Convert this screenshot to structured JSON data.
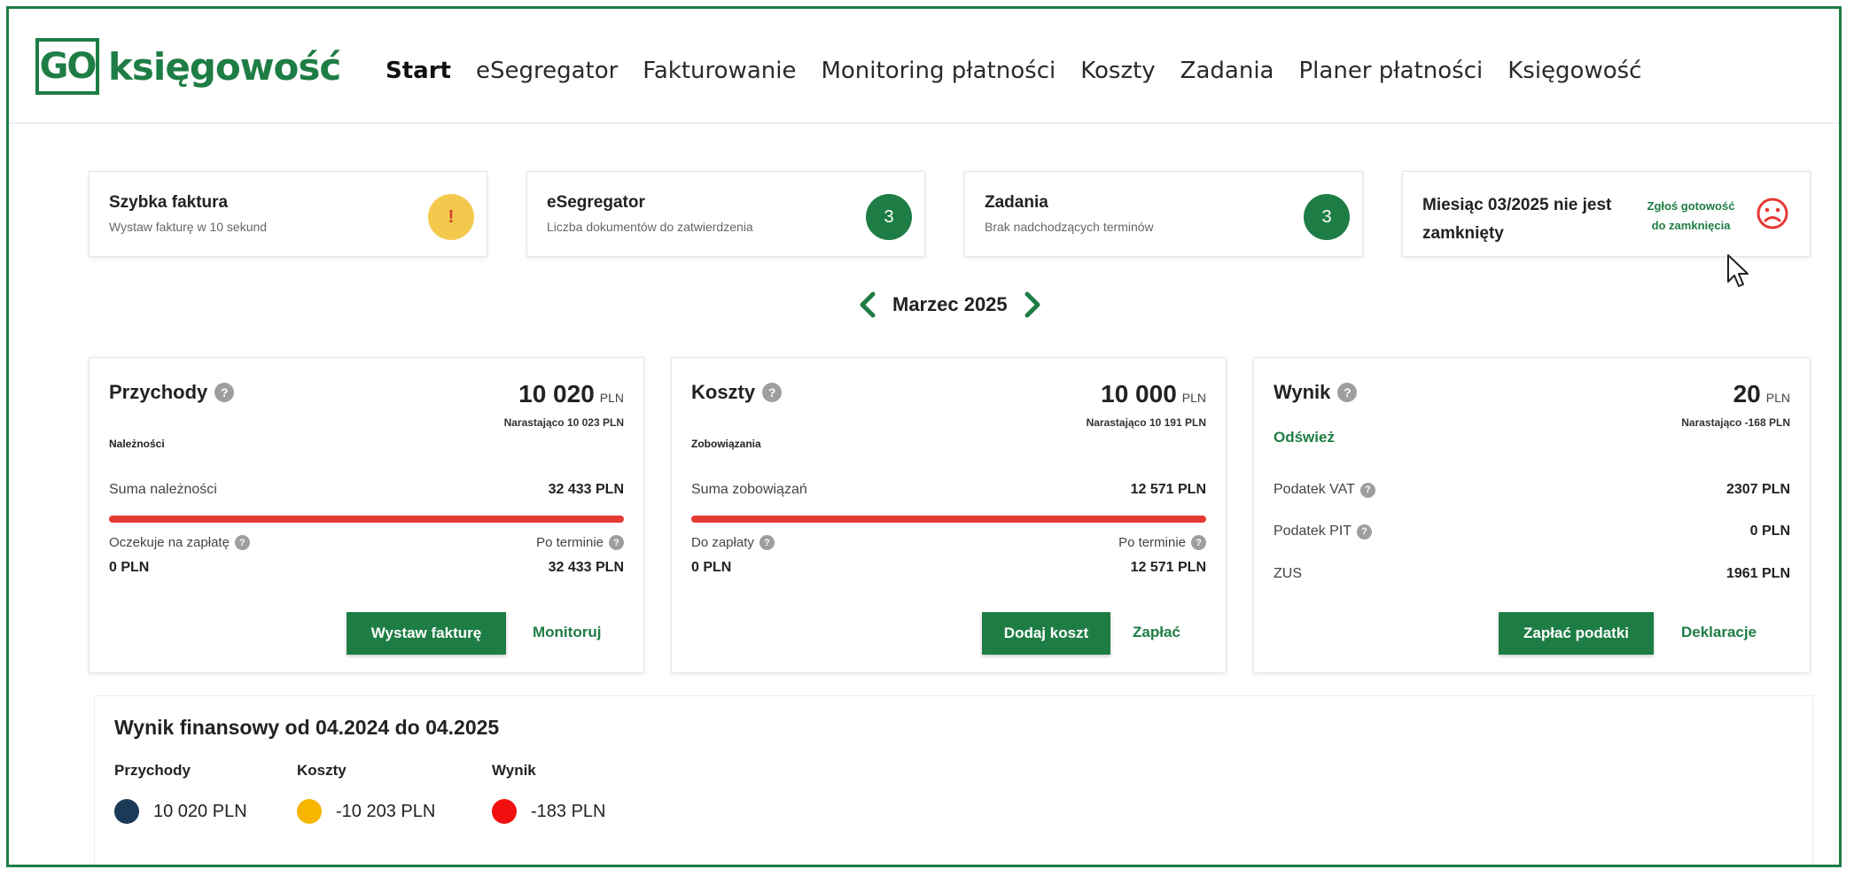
{
  "header": {
    "logo_box": "GO",
    "logo_text": "księgowość",
    "nav": [
      "Start",
      "eSegregator",
      "Fakturowanie",
      "Monitoring płatności",
      "Koszty",
      "Zadania",
      "Planer płatności",
      "Księgowość"
    ]
  },
  "tiles": {
    "quick_invoice": {
      "title": "Szybka faktura",
      "subtitle": "Wystaw fakturę w 10 sekund",
      "badge": "!"
    },
    "esegregator": {
      "title": "eSegregator",
      "subtitle": "Liczba dokumentów do zatwierdzenia",
      "badge": "3"
    },
    "tasks": {
      "title": "Zadania",
      "subtitle": "Brak nadchodzących terminów",
      "badge": "3"
    },
    "month": {
      "title": "Miesiąc 03/2025 nie jest zamknięty",
      "link": "Zgłoś gotowość do zamknięcia"
    }
  },
  "month_switch": {
    "label": "Marzec 2025"
  },
  "revenue": {
    "title": "Przychody",
    "amount": "10 020",
    "currency": "PLN",
    "cumulative": "Narastająco 10 023 PLN",
    "sublabel": "Należności",
    "sum_label": "Suma należności",
    "sum_value": "32 433 PLN",
    "waiting_label": "Oczekuje na zapłatę",
    "waiting_value": "0 PLN",
    "overdue_label": "Po terminie",
    "overdue_value": "32 433 PLN",
    "button": "Wystaw fakturę",
    "link": "Monitoruj"
  },
  "costs": {
    "title": "Koszty",
    "amount": "10 000",
    "currency": "PLN",
    "cumulative": "Narastająco 10 191 PLN",
    "sublabel": "Zobowiązania",
    "sum_label": "Suma zobowiązań",
    "sum_value": "12 571 PLN",
    "topay_label": "Do zapłaty",
    "topay_value": "0 PLN",
    "overdue_label": "Po terminie",
    "overdue_value": "12 571 PLN",
    "button": "Dodaj koszt",
    "link": "Zapłać"
  },
  "result": {
    "title": "Wynik",
    "amount": "20",
    "currency": "PLN",
    "cumulative": "Narastająco -168 PLN",
    "refresh": "Odśwież",
    "vat_label": "Podatek VAT",
    "vat_value": "2307 PLN",
    "pit_label": "Podatek PIT",
    "pit_value": "0 PLN",
    "zus_label": "ZUS",
    "zus_value": "1961 PLN",
    "button": "Zapłać podatki",
    "link": "Deklaracje"
  },
  "financial": {
    "title": "Wynik finansowy od 04.2024 do 04.2025",
    "legend": [
      {
        "name": "Przychody",
        "value": "10 020 PLN",
        "color": "#1b3a57"
      },
      {
        "name": "Koszty",
        "value": "-10 203 PLN",
        "color": "#f7b500"
      },
      {
        "name": "Wynik",
        "value": "-183 PLN",
        "color": "#f20f0f"
      }
    ]
  },
  "colors": {
    "brand_green": "#1e7d45",
    "bar_red": "#e53935"
  }
}
